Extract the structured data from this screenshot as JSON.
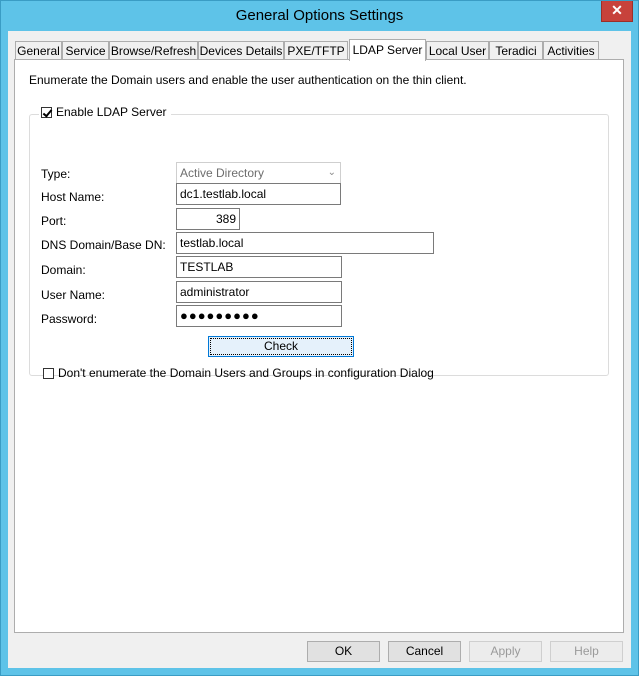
{
  "window": {
    "title": "General Options Settings",
    "close_glyph": "✕"
  },
  "tabs": [
    {
      "label": "General"
    },
    {
      "label": "Service"
    },
    {
      "label": "Browse/Refresh"
    },
    {
      "label": "Devices Details"
    },
    {
      "label": "PXE/TFTP"
    },
    {
      "label": "LDAP Server",
      "active": true
    },
    {
      "label": "Local User"
    },
    {
      "label": "Teradici"
    },
    {
      "label": "Activities"
    }
  ],
  "panel": {
    "description": "Enumerate the Domain users and enable the user authentication on the thin client.",
    "enable_ldap": {
      "label": "Enable LDAP Server",
      "checked": true
    },
    "fields": {
      "type": {
        "label": "Type:",
        "value": "Active Directory"
      },
      "host_name": {
        "label": "Host Name:",
        "value": "dc1.testlab.local"
      },
      "port": {
        "label": "Port:",
        "value": "389"
      },
      "dns_domain": {
        "label": "DNS Domain/Base DN:",
        "value": "testlab.local"
      },
      "domain": {
        "label": "Domain:",
        "value": "TESTLAB"
      },
      "user_name": {
        "label": "User Name:",
        "value": "administrator"
      },
      "password": {
        "label": "Password:",
        "value": "●●●●●●●●●"
      }
    },
    "check_button": "Check",
    "dont_enumerate": {
      "label": "Don't enumerate the Domain Users and Groups in configuration Dialog",
      "checked": false
    }
  },
  "footer": {
    "ok": "OK",
    "cancel": "Cancel",
    "apply": "Apply",
    "help": "Help"
  }
}
